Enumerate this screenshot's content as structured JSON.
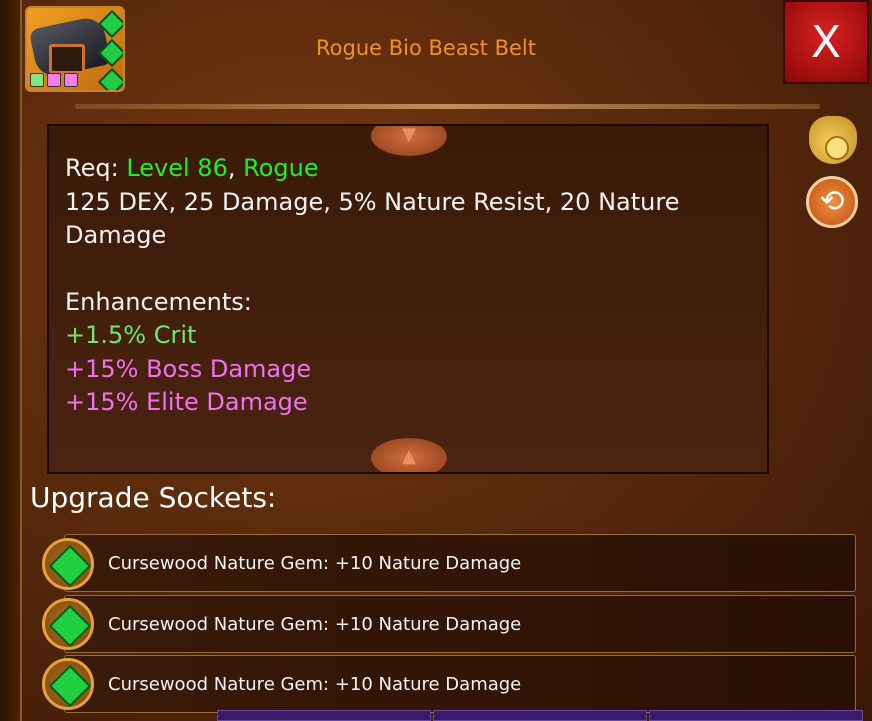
{
  "item": {
    "name": "Rogue Bio Beast Belt",
    "icon": "belt-icon",
    "gem_slots": 3,
    "dot_colors": [
      "#7ee87e",
      "#f080f0",
      "#f080f0"
    ]
  },
  "close_label": "X",
  "description": {
    "req_label": "Req: ",
    "req_level": "Level 86",
    "req_sep": ", ",
    "req_class": "Rogue",
    "stats_line": "125 DEX, 25 Damage, 5% Nature Resist, 20 Nature Damage",
    "enhancements_title": "Enhancements:",
    "enhancements": [
      {
        "text": "+1.5% Crit",
        "color": "#6ee86e"
      },
      {
        "text": "+15% Boss Damage",
        "color": "#f070f0"
      },
      {
        "text": "+15% Elite Damage",
        "color": "#f070f0"
      }
    ]
  },
  "sockets": {
    "title": "Upgrade Sockets:",
    "items": [
      {
        "label": "Cursewood Nature Gem: +10 Nature Damage",
        "icon": "green-gem-icon"
      },
      {
        "label": "Cursewood Nature Gem: +10 Nature Damage",
        "icon": "green-gem-icon"
      },
      {
        "label": "Cursewood Nature Gem: +10 Nature Damage",
        "icon": "green-gem-icon"
      }
    ]
  },
  "colors": {
    "title": "#f0902a",
    "req_highlight": "#22ee22",
    "close_bg": "#d82020"
  }
}
